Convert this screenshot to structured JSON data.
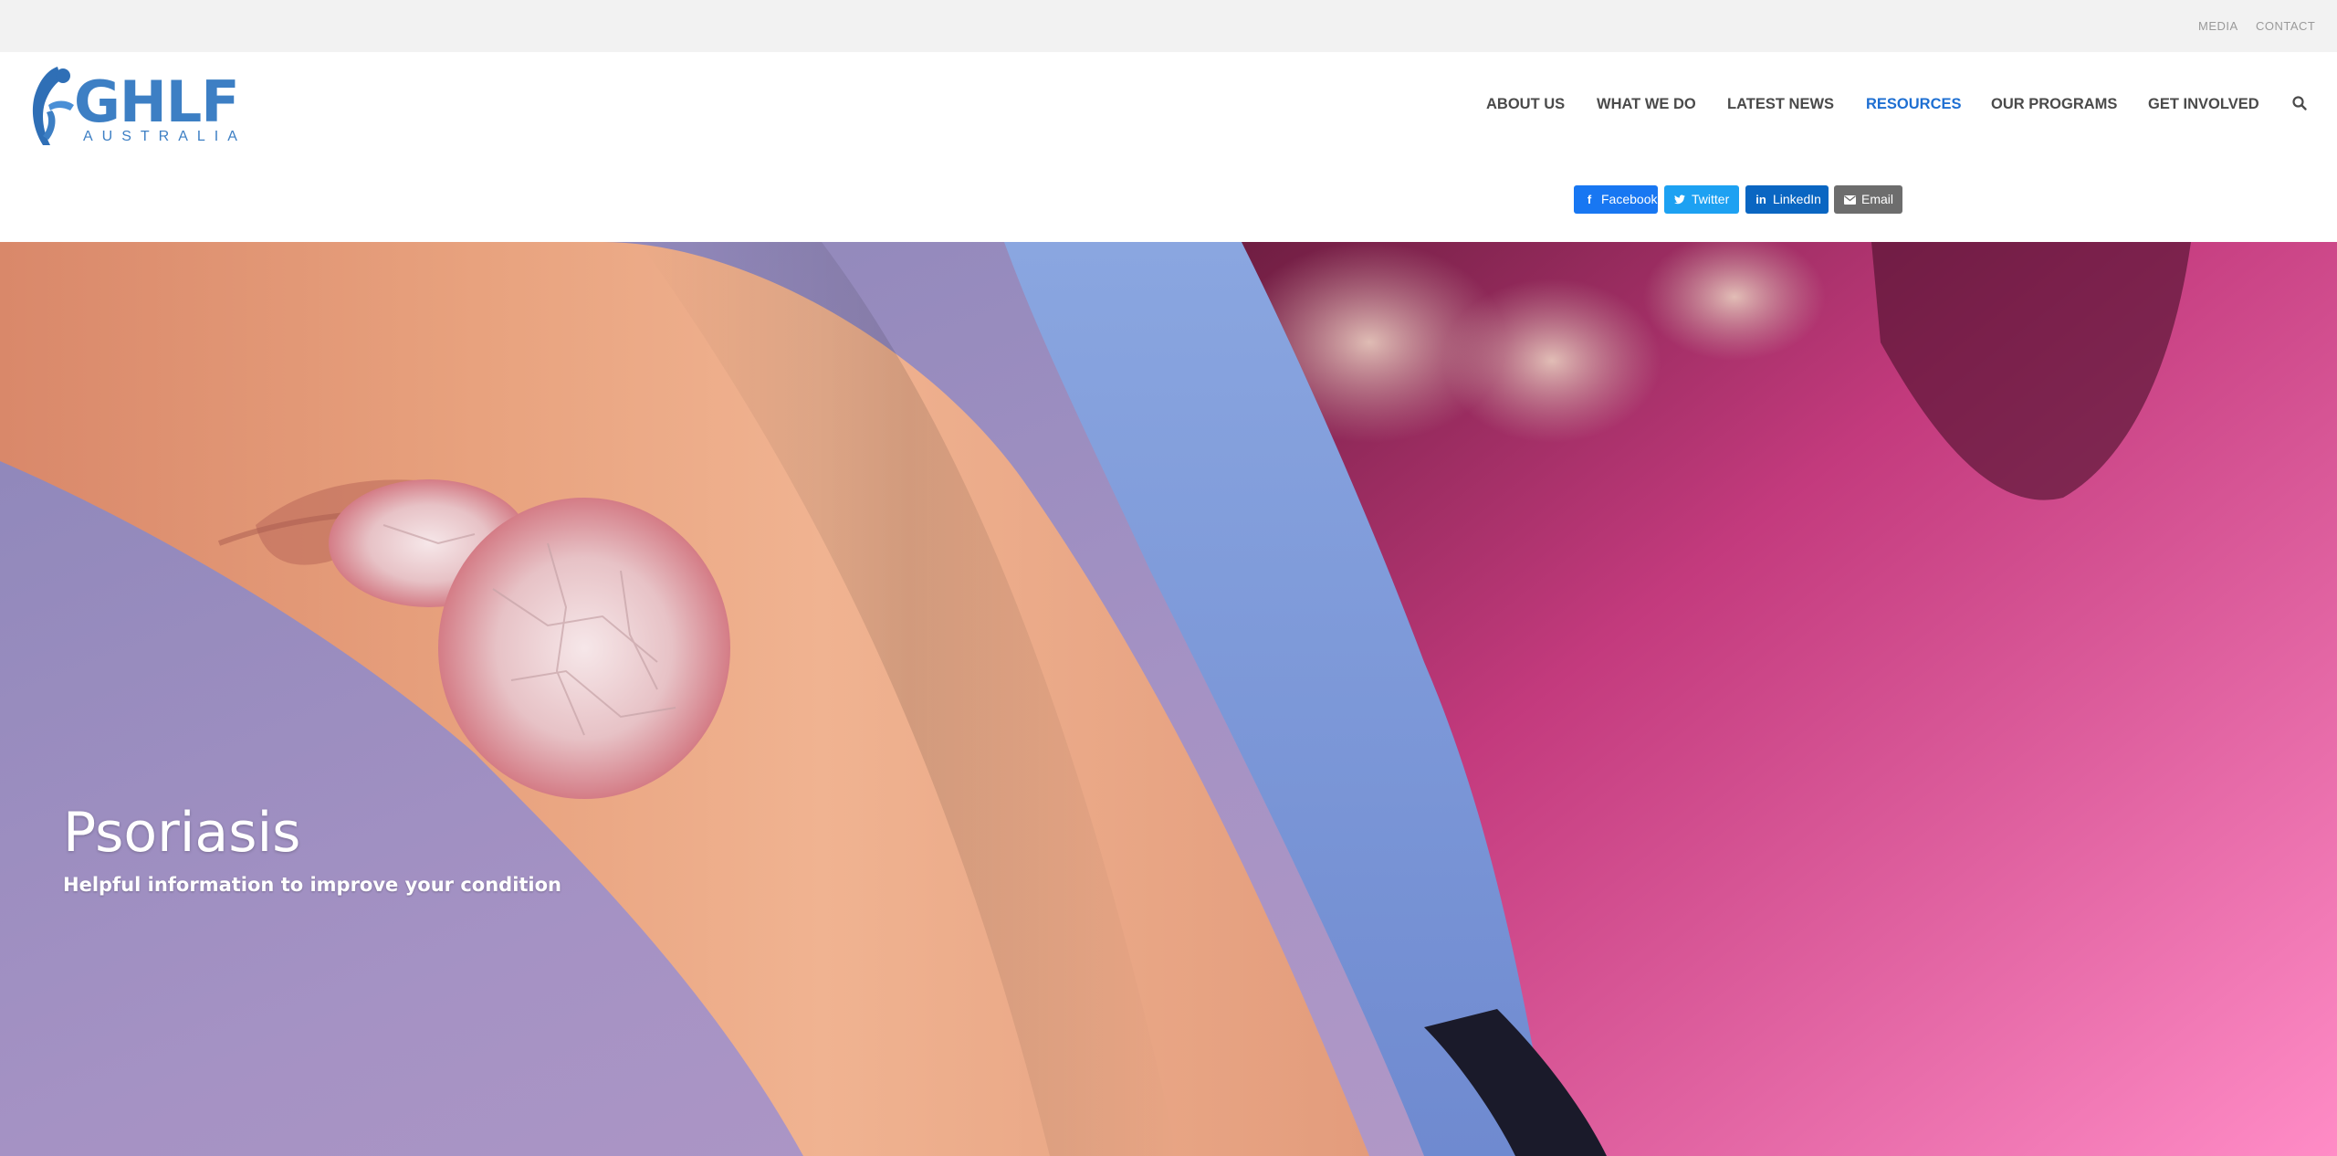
{
  "topbar": {
    "media_label": "MEDIA",
    "contact_label": "CONTACT"
  },
  "logo": {
    "letters": "GHLF",
    "subtitle": "AUSTRALIA",
    "brand_color": "#3d7fc4"
  },
  "nav": {
    "items": [
      {
        "label": "ABOUT US"
      },
      {
        "label": "WHAT WE DO"
      },
      {
        "label": "LATEST NEWS"
      },
      {
        "label": "RESOURCES",
        "active": true
      },
      {
        "label": "OUR PROGRAMS"
      },
      {
        "label": "GET INVOLVED"
      }
    ],
    "active_color": "#1e6fd2",
    "search_icon": "search-icon"
  },
  "share": {
    "facebook": {
      "label": "Facebook",
      "icon": "facebook-icon",
      "color": "#1877f2"
    },
    "twitter": {
      "label": "Twitter",
      "icon": "twitter-icon",
      "color": "#1da1f2"
    },
    "linkedin": {
      "label": "LinkedIn",
      "icon": "linkedin-icon",
      "color": "#0a66c2"
    },
    "email": {
      "label": "Email",
      "icon": "envelope-icon",
      "color": "#6d6d6d"
    }
  },
  "hero": {
    "title": "Psoriasis",
    "subtitle": "Helpful information to improve your condition"
  }
}
